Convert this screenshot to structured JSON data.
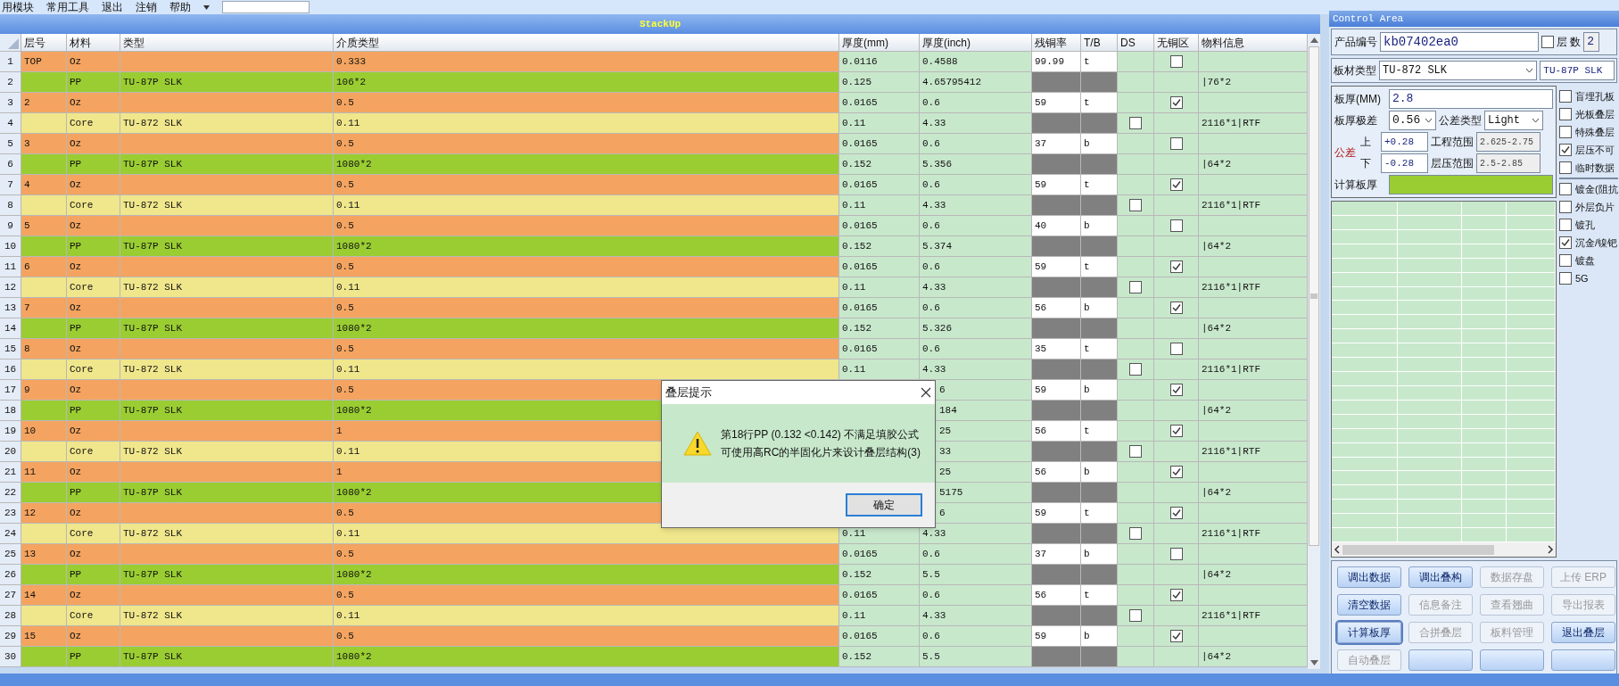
{
  "menu": [
    "用模块",
    "常用工具",
    "退出",
    "注销",
    "帮助"
  ],
  "stackup": {
    "title": "StackUp",
    "columns": [
      "层号",
      "材料",
      "类型",
      "介质类型",
      "厚度(mm)",
      "厚度(inch)",
      "残铜率",
      "T/B",
      "DS",
      "无铜区",
      "物料信息"
    ],
    "rows": [
      {
        "num": "1",
        "kind": "copper",
        "layer": "TOP",
        "material": "Oz",
        "dielectric": "0.333",
        "mm": "0.0116",
        "inch": "0.4588",
        "residual": "99.99",
        "tb": "t",
        "no_copper": false,
        "covered": false
      },
      {
        "num": "2",
        "kind": "prepreg",
        "material": "PP",
        "type": "TU-87P SLK",
        "dielectric": "106*2",
        "mm": "0.125",
        "inch": "4.65795412",
        "info": "|76*2",
        "covered": false
      },
      {
        "num": "3",
        "kind": "copper",
        "layer": "2",
        "material": "Oz",
        "dielectric": "0.5",
        "mm": "0.0165",
        "inch": "0.6",
        "residual": "59",
        "tb": "t",
        "no_copper": true,
        "covered": false
      },
      {
        "num": "4",
        "kind": "core",
        "material": "Core",
        "type": "TU-872 SLK",
        "dielectric": "0.11",
        "mm": "0.11",
        "inch": "4.33",
        "ds": false,
        "info": "2116*1|RTF",
        "covered": false
      },
      {
        "num": "5",
        "kind": "copper",
        "layer": "3",
        "material": "Oz",
        "dielectric": "0.5",
        "mm": "0.0165",
        "inch": "0.6",
        "residual": "37",
        "tb": "b",
        "no_copper": false,
        "covered": false
      },
      {
        "num": "6",
        "kind": "prepreg",
        "material": "PP",
        "type": "TU-87P SLK",
        "dielectric": "1080*2",
        "mm": "0.152",
        "inch": "5.356",
        "info": "|64*2",
        "covered": false
      },
      {
        "num": "7",
        "kind": "copper",
        "layer": "4",
        "material": "Oz",
        "dielectric": "0.5",
        "mm": "0.0165",
        "inch": "0.6",
        "residual": "59",
        "tb": "t",
        "no_copper": true,
        "covered": false
      },
      {
        "num": "8",
        "kind": "core",
        "material": "Core",
        "type": "TU-872 SLK",
        "dielectric": "0.11",
        "mm": "0.11",
        "inch": "4.33",
        "ds": false,
        "info": "2116*1|RTF",
        "covered": false
      },
      {
        "num": "9",
        "kind": "copper",
        "layer": "5",
        "material": "Oz",
        "dielectric": "0.5",
        "mm": "0.0165",
        "inch": "0.6",
        "residual": "40",
        "tb": "b",
        "no_copper": false,
        "covered": false
      },
      {
        "num": "10",
        "kind": "prepreg",
        "material": "PP",
        "type": "TU-87P SLK",
        "dielectric": "1080*2",
        "mm": "0.152",
        "inch": "5.374",
        "info": "|64*2",
        "covered": false
      },
      {
        "num": "11",
        "kind": "copper",
        "layer": "6",
        "material": "Oz",
        "dielectric": "0.5",
        "mm": "0.0165",
        "inch": "0.6",
        "residual": "59",
        "tb": "t",
        "no_copper": true,
        "covered": false
      },
      {
        "num": "12",
        "kind": "core",
        "material": "Core",
        "type": "TU-872 SLK",
        "dielectric": "0.11",
        "mm": "0.11",
        "inch": "4.33",
        "ds": false,
        "info": "2116*1|RTF",
        "covered": false
      },
      {
        "num": "13",
        "kind": "copper",
        "layer": "7",
        "material": "Oz",
        "dielectric": "0.5",
        "mm": "0.0165",
        "inch": "0.6",
        "residual": "56",
        "tb": "b",
        "no_copper": true,
        "covered": false
      },
      {
        "num": "14",
        "kind": "prepreg",
        "material": "PP",
        "type": "TU-87P SLK",
        "dielectric": "1080*2",
        "mm": "0.152",
        "inch": "5.326",
        "info": "|64*2",
        "covered": false
      },
      {
        "num": "15",
        "kind": "copper",
        "layer": "8",
        "material": "Oz",
        "dielectric": "0.5",
        "mm": "0.0165",
        "inch": "0.6",
        "residual": "35",
        "tb": "t",
        "no_copper": false,
        "covered": false
      },
      {
        "num": "16",
        "kind": "core",
        "material": "Core",
        "type": "TU-872 SLK",
        "dielectric": "0.11",
        "mm": "0.11",
        "inch": "4.33",
        "ds": false,
        "info": "2116*1|RTF",
        "covered": false
      },
      {
        "num": "17",
        "kind": "copper",
        "layer": "9",
        "material": "Oz",
        "dielectric": "0.5",
        "inch": "6",
        "residual": "59",
        "tb": "b",
        "no_copper": true,
        "covered": true
      },
      {
        "num": "18",
        "kind": "prepreg",
        "material": "PP",
        "type": "TU-87P SLK",
        "dielectric": "1080*2",
        "inch": "184",
        "info": "|64*2",
        "covered": true
      },
      {
        "num": "19",
        "kind": "copper",
        "layer": "10",
        "material": "Oz",
        "dielectric": "1",
        "inch": "25",
        "residual": "56",
        "tb": "t",
        "no_copper": true,
        "covered": true
      },
      {
        "num": "20",
        "kind": "core",
        "material": "Core",
        "type": "TU-872 SLK",
        "dielectric": "0.11",
        "inch": "33",
        "ds": false,
        "info": "2116*1|RTF",
        "covered": true
      },
      {
        "num": "21",
        "kind": "copper",
        "layer": "11",
        "material": "Oz",
        "dielectric": "1",
        "inch": "25",
        "residual": "56",
        "tb": "b",
        "no_copper": true,
        "covered": true
      },
      {
        "num": "22",
        "kind": "prepreg",
        "material": "PP",
        "type": "TU-87P SLK",
        "dielectric": "1080*2",
        "inch": "5175",
        "info": "|64*2",
        "covered": true
      },
      {
        "num": "23",
        "kind": "copper",
        "layer": "12",
        "material": "Oz",
        "dielectric": "0.5",
        "inch": "6",
        "residual": "59",
        "tb": "t",
        "no_copper": true,
        "covered": true
      },
      {
        "num": "24",
        "kind": "core",
        "material": "Core",
        "type": "TU-872 SLK",
        "dielectric": "0.11",
        "mm": "0.11",
        "inch": "4.33",
        "ds": false,
        "info": "2116*1|RTF",
        "covered": false
      },
      {
        "num": "25",
        "kind": "copper",
        "layer": "13",
        "material": "Oz",
        "dielectric": "0.5",
        "mm": "0.0165",
        "inch": "0.6",
        "residual": "37",
        "tb": "b",
        "no_copper": false,
        "covered": false
      },
      {
        "num": "26",
        "kind": "prepreg",
        "material": "PP",
        "type": "TU-87P SLK",
        "dielectric": "1080*2",
        "mm": "0.152",
        "inch": "5.5",
        "info": "|64*2",
        "covered": false
      },
      {
        "num": "27",
        "kind": "copper",
        "layer": "14",
        "material": "Oz",
        "dielectric": "0.5",
        "mm": "0.0165",
        "inch": "0.6",
        "residual": "56",
        "tb": "t",
        "no_copper": true,
        "covered": false
      },
      {
        "num": "28",
        "kind": "core",
        "material": "Core",
        "type": "TU-872 SLK",
        "dielectric": "0.11",
        "mm": "0.11",
        "inch": "4.33",
        "ds": false,
        "info": "2116*1|RTF",
        "covered": false
      },
      {
        "num": "29",
        "kind": "copper",
        "layer": "15",
        "material": "Oz",
        "dielectric": "0.5",
        "mm": "0.0165",
        "inch": "0.6",
        "residual": "59",
        "tb": "b",
        "no_copper": true,
        "covered": false
      },
      {
        "num": "30",
        "kind": "prepreg",
        "material": "PP",
        "type": "TU-87P SLK",
        "dielectric": "1080*2",
        "mm": "0.152",
        "inch": "5.5",
        "info": "|64*2",
        "covered": false
      }
    ]
  },
  "control": {
    "title": "Control Area",
    "product_no": {
      "label": "产品编号",
      "value": "kb07402ea0"
    },
    "layer_count": {
      "label": "层 数",
      "checked": false,
      "value": "2"
    },
    "board_type": {
      "label": "板材类型",
      "value": "TU-872 SLK",
      "second_value": "TU-87P SLK"
    },
    "thickness": {
      "label": "板厚(MM)",
      "value": "2.8"
    },
    "range": {
      "label": "板厚极差",
      "value": "0.56"
    },
    "tol_type": {
      "label": "公差类型",
      "value": "Light"
    },
    "tolerance": {
      "label": "公差",
      "upper_label": "上",
      "upper": "+0.28",
      "lower_label": "下",
      "lower": "-0.28"
    },
    "eng_range": {
      "label": "工程范围",
      "value": "2.625-2.75"
    },
    "lam_range": {
      "label": "层压范围",
      "value": "2.5-2.85"
    },
    "calc": {
      "label": "计算板厚"
    },
    "options_a": [
      {
        "label": "盲埋孔板",
        "checked": false
      },
      {
        "label": "光板叠层",
        "checked": false
      },
      {
        "label": "特殊叠层",
        "checked": false
      },
      {
        "label": "层压不可",
        "checked": true
      },
      {
        "label": "临时数据",
        "checked": false
      }
    ],
    "options_b": [
      {
        "label": "镀金(阻抗",
        "checked": false
      },
      {
        "label": "外层负片",
        "checked": false
      },
      {
        "label": "镀孔",
        "checked": false
      },
      {
        "label": "沉金/镍钯",
        "checked": true
      },
      {
        "label": "镀盘",
        "checked": false
      },
      {
        "label": "5G",
        "checked": false
      }
    ],
    "buttons": [
      {
        "label": "调出数据",
        "disabled": false,
        "focused": false
      },
      {
        "label": "调出叠构",
        "disabled": false,
        "focused": false
      },
      {
        "label": "数据存盘",
        "disabled": true,
        "focused": false
      },
      {
        "label": "上传 ERP",
        "disabled": true,
        "focused": false
      },
      {
        "label": "清空数据",
        "disabled": false,
        "focused": false
      },
      {
        "label": "信息备注",
        "disabled": true,
        "focused": false
      },
      {
        "label": "查看翘曲",
        "disabled": true,
        "focused": false
      },
      {
        "label": "导出报表",
        "disabled": true,
        "focused": false
      },
      {
        "label": "计算板厚",
        "disabled": false,
        "focused": true
      },
      {
        "label": "合拼叠层",
        "disabled": true,
        "focused": false
      },
      {
        "label": "板料管理",
        "disabled": true,
        "focused": false
      },
      {
        "label": "退出叠层",
        "disabled": false,
        "focused": false
      },
      {
        "label": "自动叠层",
        "disabled": true,
        "focused": false
      },
      {
        "disabled": false,
        "focused": false
      },
      {
        "disabled": false,
        "focused": false
      },
      {
        "disabled": false,
        "focused": false
      }
    ]
  },
  "dialog": {
    "title": "叠层提示",
    "lines": [
      "第18行PP (0.132 <0.142) 不满足填胶公式",
      "可使用高RC的半固化片来设计叠层结构(3)"
    ],
    "button": "确定"
  }
}
